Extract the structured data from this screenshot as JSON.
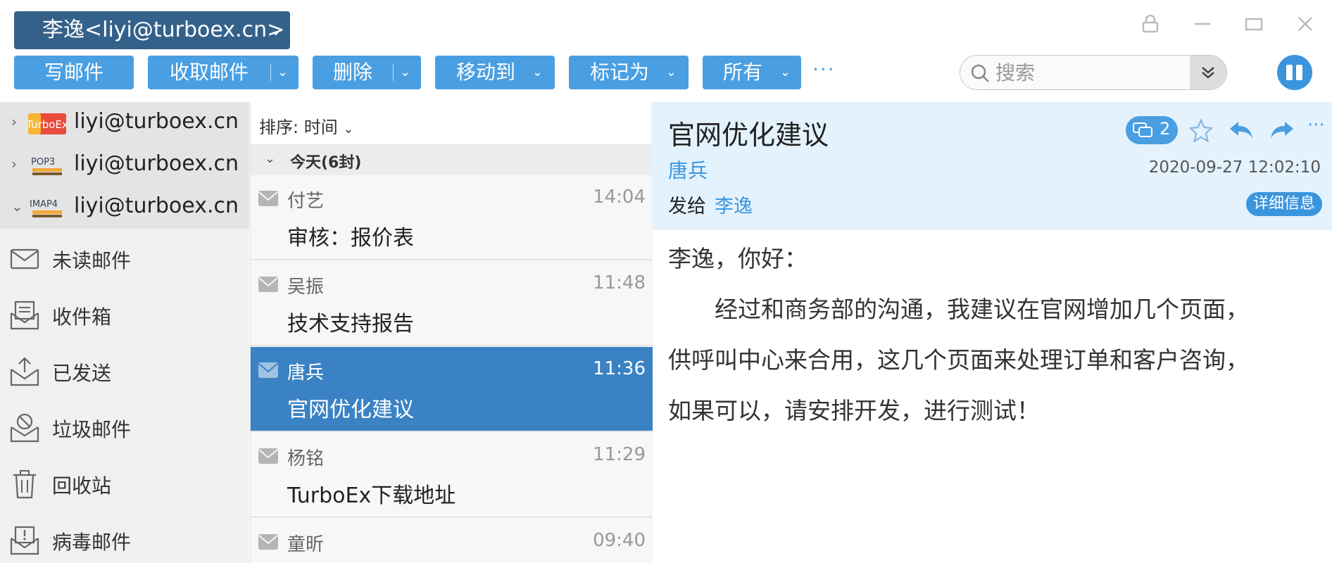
{
  "header": {
    "account_selector": "李逸<liyi@turboex.cn>",
    "window_controls": [
      "lock-icon",
      "minimize-icon",
      "maximize-icon",
      "close-icon"
    ]
  },
  "toolbar": {
    "compose": "写邮件",
    "receive": "收取邮件",
    "delete": "删除",
    "move_to": "移动到",
    "mark_as": "标记为",
    "filter_all": "所有",
    "more": "···"
  },
  "search": {
    "placeholder": "搜索"
  },
  "sidebar": {
    "accounts": [
      {
        "logo": "TurboEx",
        "address": "liyi@turboex.cn"
      },
      {
        "logo": "POP3",
        "address": "liyi@turboex.cn"
      },
      {
        "logo": "IMAP4",
        "address": "liyi@turboex.cn"
      }
    ],
    "folders": [
      {
        "label": "未读邮件",
        "icon": "envelope-icon"
      },
      {
        "label": "收件箱",
        "icon": "inbox-icon"
      },
      {
        "label": "已发送",
        "icon": "sent-icon"
      },
      {
        "label": "垃圾邮件",
        "icon": "spam-icon"
      },
      {
        "label": "回收站",
        "icon": "trash-icon"
      },
      {
        "label": "病毒邮件",
        "icon": "virus-icon"
      }
    ]
  },
  "mail_list": {
    "sort_label": "排序: 时间",
    "group_label": "今天(6封)",
    "items": [
      {
        "sender": "付艺",
        "time": "14:04",
        "subject": "审核：报价表"
      },
      {
        "sender": "吴振",
        "time": "11:48",
        "subject": "技术支持报告"
      },
      {
        "sender": "唐兵",
        "time": "11:36",
        "subject": "官网优化建议"
      },
      {
        "sender": "杨铭",
        "time": "11:29",
        "subject": "TurboEx下载地址"
      },
      {
        "sender": "童昕",
        "time": "09:40",
        "subject": ""
      }
    ]
  },
  "reader": {
    "subject": "官网优化建议",
    "chat_count": "2",
    "from": "唐兵",
    "date": "2020-09-27 12:02:10",
    "to_label": "发给",
    "to": "李逸",
    "details_button": "详细信息",
    "greeting": "李逸，你好：",
    "body_lines": [
      "　　经过和商务部的沟通，我建议在官网增加几个页面，",
      "供呼叫中心来合用，这几个页面来处理订单和客户咨询，",
      "如果可以，请安排开发，进行测试！"
    ]
  },
  "colors": {
    "primary_button": "#4a9fe2",
    "account_bar": "#34618a",
    "selected_row": "#3a82c4",
    "reader_header": "#e3f2fd",
    "link": "#3b95dd"
  }
}
